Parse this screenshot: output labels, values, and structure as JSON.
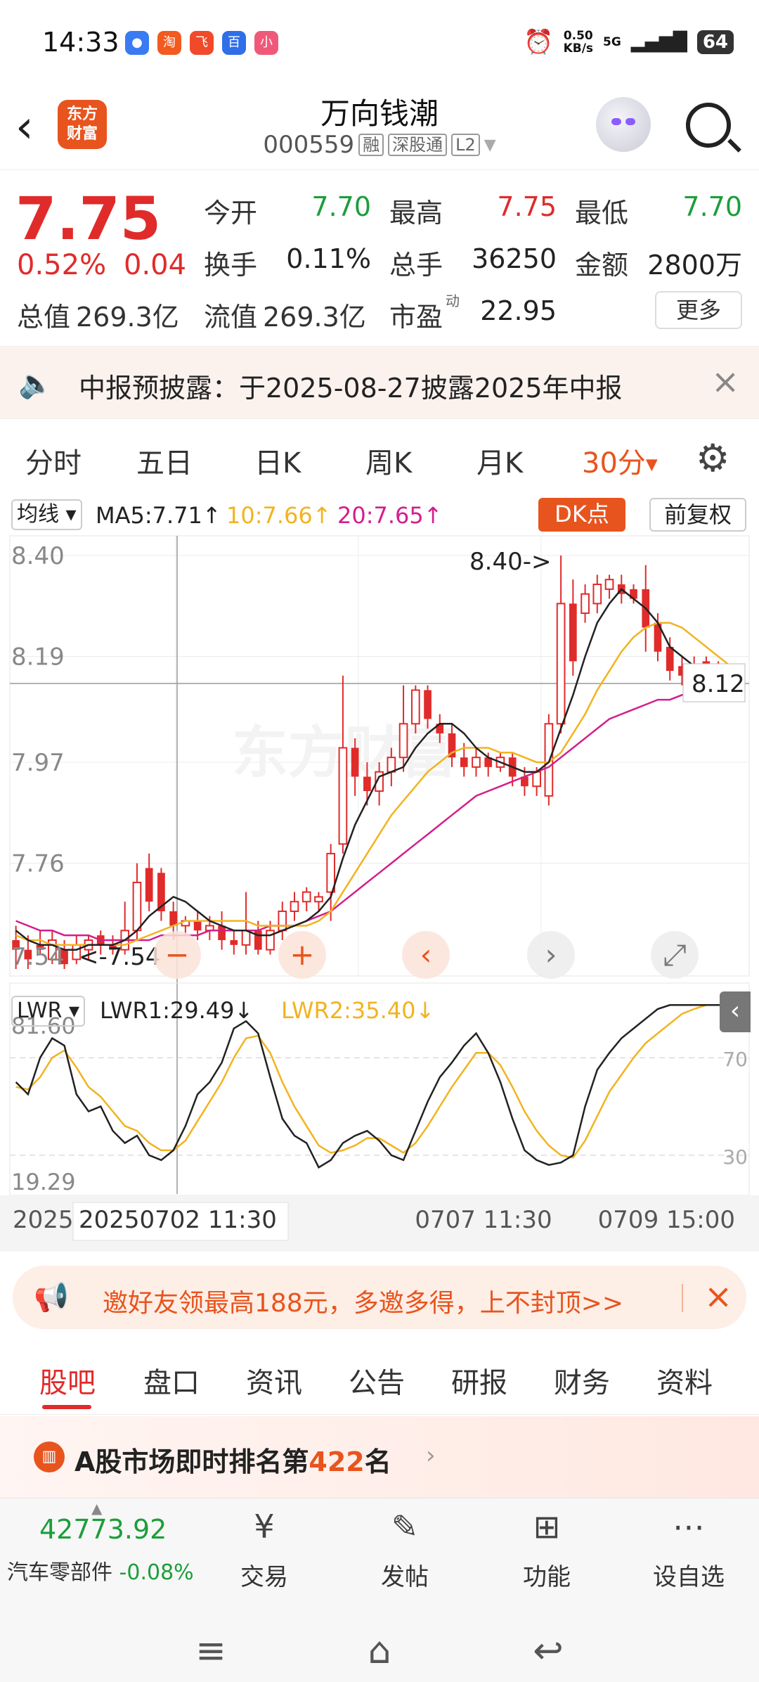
{
  "status_bar": {
    "time": "14:33",
    "apps": [
      "QQ浏览器",
      "淘",
      "飞",
      "百",
      "小"
    ],
    "net_speed_value": "0.50",
    "net_speed_unit": "KB/s",
    "signal": "5G",
    "battery": "64"
  },
  "header": {
    "back_label": "‹",
    "logo_line1": "东方",
    "logo_line2": "财富",
    "stock_name": "万向钱潮",
    "stock_code": "000559",
    "tags": [
      "融",
      "深股通",
      "L2"
    ]
  },
  "quote": {
    "price": "7.75",
    "change_pct": "0.52%",
    "change_val": "0.04",
    "open_label": "今开",
    "open": "7.70",
    "high_label": "最高",
    "high": "7.75",
    "low_label": "最低",
    "low": "7.70",
    "turnover_label": "换手",
    "turnover": "0.11%",
    "volume_label": "总手",
    "volume": "36250",
    "amount_label": "金额",
    "amount": "2800万",
    "mktcap_label": "总值",
    "mktcap": "269.3亿",
    "float_label": "流值",
    "float_cap": "269.3亿",
    "pe_label": "市盈",
    "pe_sup": "动",
    "pe": "22.95",
    "more_label": "更多"
  },
  "notice": {
    "text": "中报预披露：于2025-08-27披露2025年中报",
    "close": "×"
  },
  "tabs": {
    "items": [
      "分时",
      "五日",
      "日K",
      "周K",
      "月K"
    ],
    "active": "30分"
  },
  "ma": {
    "select": "均线",
    "ma5": "MA5:7.71↑",
    "ma10": "10:7.66↑",
    "ma20": "20:7.65↑",
    "ma10_color": "#f2b320",
    "ma20_color": "#d21f8e",
    "dk_label": "DK点",
    "fq_label": "前复权"
  },
  "lwr": {
    "select": "LWR",
    "lwr1": "LWR1:29.49↓",
    "lwr2": "LWR2:35.40↓",
    "lwr2_color": "#f2b320"
  },
  "chart_data": {
    "type": "candlestick",
    "period": "30分",
    "y_ticks": [
      "8.40",
      "8.19",
      "7.97",
      "7.76",
      "7.54"
    ],
    "ylim": [
      7.54,
      8.4
    ],
    "annotations": [
      "8.40->",
      "<-7.54"
    ],
    "last_price_label": "8.12",
    "x_ticks": [
      "2025",
      "20250702 11:30",
      "0707 11:30",
      "0709 15:00"
    ],
    "watermark": "东方财富",
    "candles": [
      {
        "o": 7.6,
        "c": 7.58,
        "h": 7.63,
        "l": 7.54
      },
      {
        "o": 7.58,
        "c": 7.56,
        "h": 7.61,
        "l": 7.54
      },
      {
        "o": 7.59,
        "c": 7.58,
        "h": 7.62,
        "l": 7.57
      },
      {
        "o": 7.56,
        "c": 7.6,
        "h": 7.62,
        "l": 7.55
      },
      {
        "o": 7.58,
        "c": 7.55,
        "h": 7.6,
        "l": 7.54
      },
      {
        "o": 7.56,
        "c": 7.59,
        "h": 7.61,
        "l": 7.55
      },
      {
        "o": 7.58,
        "c": 7.6,
        "h": 7.61,
        "l": 7.56
      },
      {
        "o": 7.61,
        "c": 7.59,
        "h": 7.62,
        "l": 7.57
      },
      {
        "o": 7.59,
        "c": 7.58,
        "h": 7.61,
        "l": 7.57
      },
      {
        "o": 7.58,
        "c": 7.62,
        "h": 7.68,
        "l": 7.57
      },
      {
        "o": 7.62,
        "c": 7.72,
        "h": 7.76,
        "l": 7.6
      },
      {
        "o": 7.75,
        "c": 7.68,
        "h": 7.78,
        "l": 7.66
      },
      {
        "o": 7.74,
        "c": 7.66,
        "h": 7.75,
        "l": 7.64
      },
      {
        "o": 7.66,
        "c": 7.63,
        "h": 7.68,
        "l": 7.6
      },
      {
        "o": 7.63,
        "c": 7.64,
        "h": 7.65,
        "l": 7.61
      },
      {
        "o": 7.64,
        "c": 7.62,
        "h": 7.66,
        "l": 7.6
      },
      {
        "o": 7.62,
        "c": 7.63,
        "h": 7.65,
        "l": 7.6
      },
      {
        "o": 7.63,
        "c": 7.6,
        "h": 7.66,
        "l": 7.58
      },
      {
        "o": 7.6,
        "c": 7.59,
        "h": 7.62,
        "l": 7.57
      },
      {
        "o": 7.59,
        "c": 7.62,
        "h": 7.7,
        "l": 7.57
      },
      {
        "o": 7.62,
        "c": 7.58,
        "h": 7.64,
        "l": 7.57
      },
      {
        "o": 7.58,
        "c": 7.62,
        "h": 7.64,
        "l": 7.57
      },
      {
        "o": 7.62,
        "c": 7.66,
        "h": 7.68,
        "l": 7.6
      },
      {
        "o": 7.66,
        "c": 7.68,
        "h": 7.7,
        "l": 7.64
      },
      {
        "o": 7.68,
        "c": 7.7,
        "h": 7.71,
        "l": 7.66
      },
      {
        "o": 7.68,
        "c": 7.69,
        "h": 7.7,
        "l": 7.66
      },
      {
        "o": 7.7,
        "c": 7.78,
        "h": 7.8,
        "l": 7.64
      },
      {
        "o": 7.8,
        "c": 8.0,
        "h": 8.15,
        "l": 7.78
      },
      {
        "o": 8.0,
        "c": 7.94,
        "h": 8.02,
        "l": 7.9
      },
      {
        "o": 7.94,
        "c": 7.91,
        "h": 7.97,
        "l": 7.88
      },
      {
        "o": 7.91,
        "c": 7.95,
        "h": 7.97,
        "l": 7.88
      },
      {
        "o": 7.95,
        "c": 7.98,
        "h": 8.0,
        "l": 7.92
      },
      {
        "o": 7.98,
        "c": 8.05,
        "h": 8.13,
        "l": 7.95
      },
      {
        "o": 8.05,
        "c": 8.12,
        "h": 8.13,
        "l": 8.03
      },
      {
        "o": 8.12,
        "c": 8.06,
        "h": 8.13,
        "l": 8.04
      },
      {
        "o": 8.05,
        "c": 8.03,
        "h": 8.07,
        "l": 8.01
      },
      {
        "o": 8.03,
        "c": 7.98,
        "h": 8.05,
        "l": 7.96
      },
      {
        "o": 7.98,
        "c": 7.96,
        "h": 8.01,
        "l": 7.94
      },
      {
        "o": 7.96,
        "c": 7.98,
        "h": 8.0,
        "l": 7.94
      },
      {
        "o": 7.98,
        "c": 7.96,
        "h": 7.99,
        "l": 7.94
      },
      {
        "o": 7.96,
        "c": 7.98,
        "h": 7.99,
        "l": 7.95
      },
      {
        "o": 7.98,
        "c": 7.94,
        "h": 7.99,
        "l": 7.92
      },
      {
        "o": 7.94,
        "c": 7.92,
        "h": 7.96,
        "l": 7.9
      },
      {
        "o": 7.92,
        "c": 7.95,
        "h": 7.96,
        "l": 7.9
      },
      {
        "o": 7.9,
        "c": 8.05,
        "h": 8.07,
        "l": 7.88
      },
      {
        "o": 8.05,
        "c": 8.3,
        "h": 8.4,
        "l": 8.03
      },
      {
        "o": 8.3,
        "c": 8.18,
        "h": 8.35,
        "l": 8.15
      },
      {
        "o": 8.28,
        "c": 8.32,
        "h": 8.34,
        "l": 8.26
      },
      {
        "o": 8.3,
        "c": 8.34,
        "h": 8.36,
        "l": 8.28
      },
      {
        "o": 8.33,
        "c": 8.35,
        "h": 8.36,
        "l": 8.31
      },
      {
        "o": 8.34,
        "c": 8.32,
        "h": 8.36,
        "l": 8.3
      },
      {
        "o": 8.33,
        "c": 8.31,
        "h": 8.34,
        "l": 8.3
      },
      {
        "o": 8.33,
        "c": 8.25,
        "h": 8.38,
        "l": 8.2
      },
      {
        "o": 8.26,
        "c": 8.2,
        "h": 8.28,
        "l": 8.18
      },
      {
        "o": 8.21,
        "c": 8.16,
        "h": 8.23,
        "l": 8.14
      },
      {
        "o": 8.17,
        "c": 8.15,
        "h": 8.19,
        "l": 8.13
      },
      {
        "o": 8.16,
        "c": 8.17,
        "h": 8.19,
        "l": 8.14
      },
      {
        "o": 8.18,
        "c": 8.17,
        "h": 8.19,
        "l": 8.15
      },
      {
        "o": 8.17,
        "c": 8.16,
        "h": 8.18,
        "l": 8.15
      },
      {
        "o": 8.16,
        "c": 8.14,
        "h": 8.17,
        "l": 8.12
      }
    ],
    "ma5": [
      7.62,
      7.6,
      7.59,
      7.59,
      7.58,
      7.58,
      7.59,
      7.59,
      7.59,
      7.6,
      7.62,
      7.65,
      7.67,
      7.69,
      7.68,
      7.66,
      7.64,
      7.63,
      7.62,
      7.62,
      7.61,
      7.61,
      7.62,
      7.63,
      7.64,
      7.66,
      7.69,
      7.77,
      7.84,
      7.89,
      7.94,
      7.95,
      7.96,
      8.0,
      8.03,
      8.05,
      8.05,
      8.03,
      8.0,
      7.98,
      7.97,
      7.96,
      7.95,
      7.95,
      7.97,
      8.04,
      8.11,
      8.19,
      8.26,
      8.3,
      8.33,
      8.31,
      8.29,
      8.26,
      8.21,
      8.19,
      8.17,
      8.16,
      8.15,
      8.14
    ],
    "ma10": [
      7.61,
      7.6,
      7.6,
      7.59,
      7.59,
      7.59,
      7.59,
      7.59,
      7.59,
      7.59,
      7.6,
      7.61,
      7.62,
      7.63,
      7.64,
      7.64,
      7.64,
      7.64,
      7.64,
      7.64,
      7.63,
      7.63,
      7.63,
      7.63,
      7.63,
      7.64,
      7.66,
      7.7,
      7.74,
      7.78,
      7.82,
      7.86,
      7.89,
      7.92,
      7.95,
      7.97,
      7.99,
      8.0,
      8.0,
      8.0,
      7.99,
      7.99,
      7.98,
      7.97,
      7.97,
      7.99,
      8.03,
      8.07,
      8.12,
      8.16,
      8.2,
      8.23,
      8.25,
      8.26,
      8.26,
      8.25,
      8.23,
      8.21,
      8.19,
      8.17
    ],
    "ma20": [
      7.64,
      7.63,
      7.62,
      7.62,
      7.61,
      7.61,
      7.61,
      7.6,
      7.6,
      7.6,
      7.6,
      7.6,
      7.61,
      7.61,
      7.61,
      7.61,
      7.62,
      7.62,
      7.62,
      7.62,
      7.62,
      7.63,
      7.63,
      7.63,
      7.64,
      7.65,
      7.66,
      7.68,
      7.7,
      7.72,
      7.74,
      7.76,
      7.78,
      7.8,
      7.82,
      7.84,
      7.86,
      7.88,
      7.9,
      7.91,
      7.92,
      7.93,
      7.94,
      7.95,
      7.96,
      7.98,
      8.0,
      8.02,
      8.04,
      8.06,
      8.07,
      8.08,
      8.09,
      8.1,
      8.1,
      8.11,
      8.11,
      8.12,
      8.12,
      8.12
    ],
    "lwr_ticks": [
      "81.60",
      "19.29"
    ],
    "lwr_guides": [
      "70",
      "30"
    ],
    "lwr_ylim": [
      19.29,
      81.6
    ],
    "lwr1": [
      60,
      55,
      70,
      78,
      75,
      55,
      48,
      50,
      40,
      35,
      38,
      30,
      28,
      32,
      42,
      55,
      60,
      68,
      82,
      85,
      80,
      62,
      45,
      38,
      35,
      25,
      28,
      35,
      38,
      40,
      36,
      30,
      28,
      40,
      52,
      62,
      68,
      75,
      80,
      72,
      60,
      45,
      32,
      28,
      26,
      27,
      30,
      50,
      65,
      72,
      78,
      82,
      86,
      90,
      92,
      95,
      96,
      97,
      98,
      99
    ],
    "lwr2": [
      58,
      57,
      62,
      70,
      73,
      66,
      58,
      54,
      48,
      42,
      40,
      35,
      32,
      32,
      36,
      44,
      52,
      60,
      70,
      78,
      79,
      72,
      60,
      50,
      42,
      34,
      31,
      32,
      34,
      37,
      37,
      34,
      31,
      35,
      42,
      50,
      58,
      65,
      72,
      72,
      67,
      58,
      48,
      40,
      34,
      30,
      29,
      36,
      46,
      56,
      63,
      70,
      76,
      80,
      84,
      88,
      90,
      92,
      94,
      95
    ]
  },
  "chart_controls": {
    "zoom_out": "−",
    "zoom_in": "+",
    "prev": "‹",
    "next": "›",
    "fullscreen": "⤢"
  },
  "promo": {
    "text": "邀好友领最高188元，多邀多得，上不封顶>>",
    "close": "×"
  },
  "sub_tabs": [
    "股吧",
    "盘口",
    "资讯",
    "公告",
    "研报",
    "财务",
    "资料"
  ],
  "rank": {
    "prefix": "A股市场即时排名第",
    "number": "422",
    "suffix": "名",
    "arrow": "›"
  },
  "bottom": {
    "index_value": "42773.92",
    "index_name": "汽车零部件",
    "index_change": "-0.08%",
    "buttons": [
      "交易",
      "发帖",
      "功能",
      "设自选"
    ]
  },
  "nav": {
    "menu": "≡",
    "home": "⌂",
    "back": "↩"
  },
  "colors": {
    "up": "#e02b2b",
    "down": "#1c9e3b",
    "brand": "#e8541e"
  }
}
